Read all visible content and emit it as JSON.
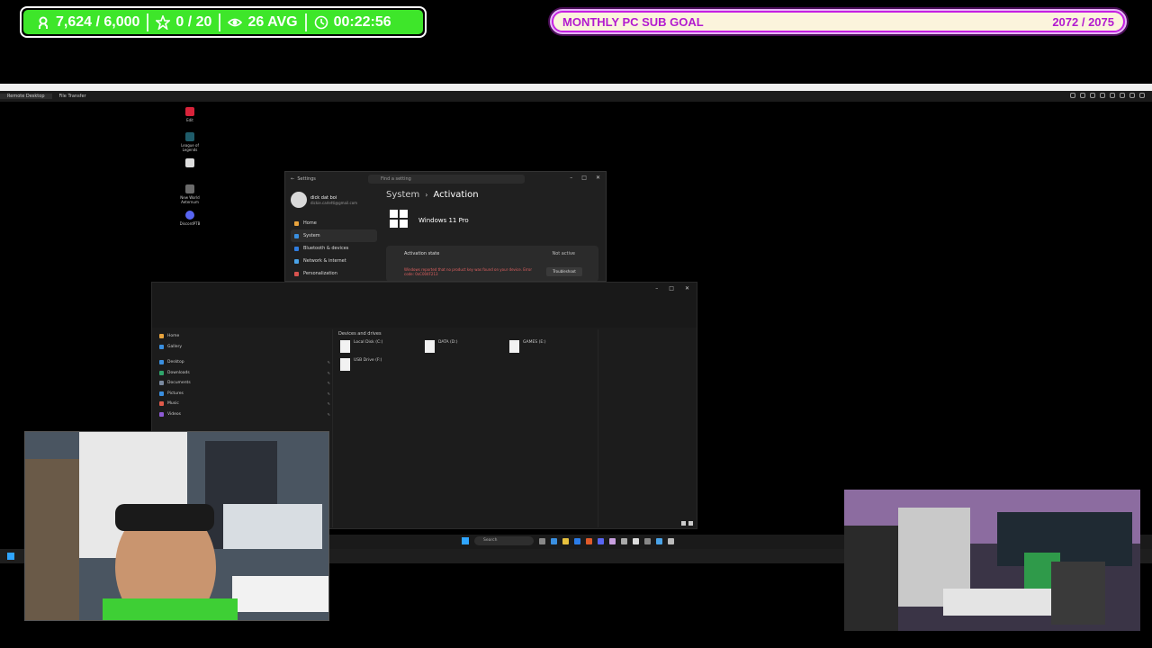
{
  "stream_stats": {
    "followers": "7,624 / 6,000",
    "stars": "0 / 20",
    "viewers": "26 AVG",
    "uptime": "00:22:56",
    "color": "#3ee62a"
  },
  "sub_goal": {
    "label": "MONTHLY PC SUB GOAL",
    "count": "2072 / 2075",
    "progress_fraction": 0.9986,
    "accent": "#c51fe3"
  },
  "remote_desktop": {
    "tabs": [
      "Remote Desktop",
      "File Transfer"
    ]
  },
  "desktop_icons": [
    "Edit",
    "League of Legends",
    "",
    "New World Aeternum",
    "DiscordPTB"
  ],
  "settings": {
    "title": "Settings",
    "search_placeholder": "Find a setting",
    "user_name": "dick dat boi",
    "user_email": "dickie.carletti@gmail.com",
    "nav": [
      "Home",
      "System",
      "Bluetooth & devices",
      "Network & internet",
      "Personalization"
    ],
    "breadcrumb_parent": "System",
    "breadcrumb_current": "Activation",
    "edition": "Windows 11 Pro",
    "activation_label": "Activation state",
    "activation_status": "Not active",
    "error_text": "Windows reported that no product key was found on your device. Error code: 0xC004F213",
    "troubleshoot": "Troubleshoot"
  },
  "explorer": {
    "nav": [
      "Home",
      "Gallery",
      "Desktop",
      "Downloads",
      "Documents",
      "Pictures",
      "Music",
      "Videos"
    ],
    "group_title": "Devices and drives",
    "drives": [
      "Local Disk (C:)",
      "DATA (D:)",
      "GAMES (E:)",
      "USB Drive (F:)"
    ]
  },
  "taskbar": {
    "search_placeholder": "Search"
  }
}
